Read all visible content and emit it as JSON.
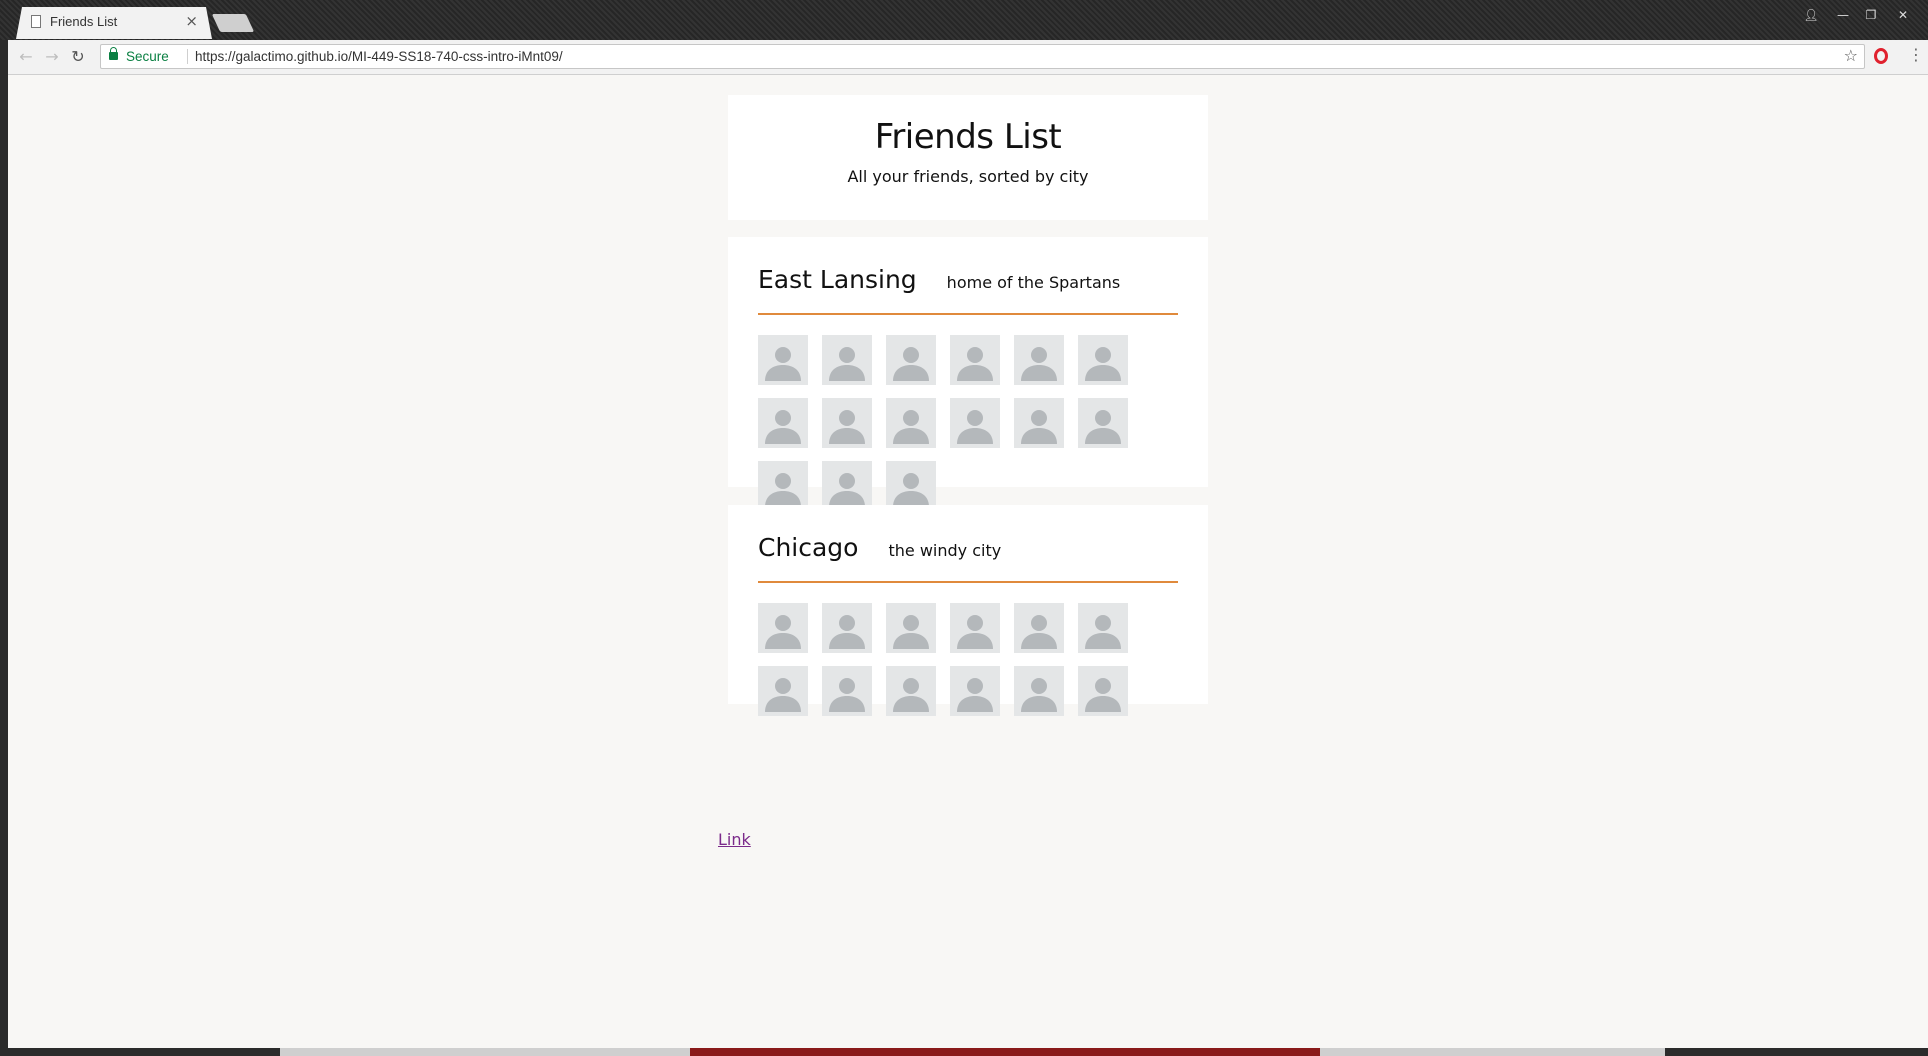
{
  "browser": {
    "tab_title": "Friends List",
    "tab_close": "×",
    "secure_label": "Secure",
    "url": "https://galactimo.github.io/MI-449-SS18-740-css-intro-iMnt09/"
  },
  "page": {
    "title": "Friends List",
    "subtitle": "All your friends, sorted by city",
    "link_text": "Link"
  },
  "cities": [
    {
      "name": "East Lansing",
      "tagline": "home of the Spartans",
      "friend_count": 15
    },
    {
      "name": "Chicago",
      "tagline": "the windy city",
      "friend_count": 12
    }
  ],
  "colors": {
    "accent_rule": "#e08a3c",
    "link": "#7b2a8a",
    "page_bg": "#f8f7f5"
  },
  "icons": {
    "avatar": "person-silhouette-icon"
  }
}
